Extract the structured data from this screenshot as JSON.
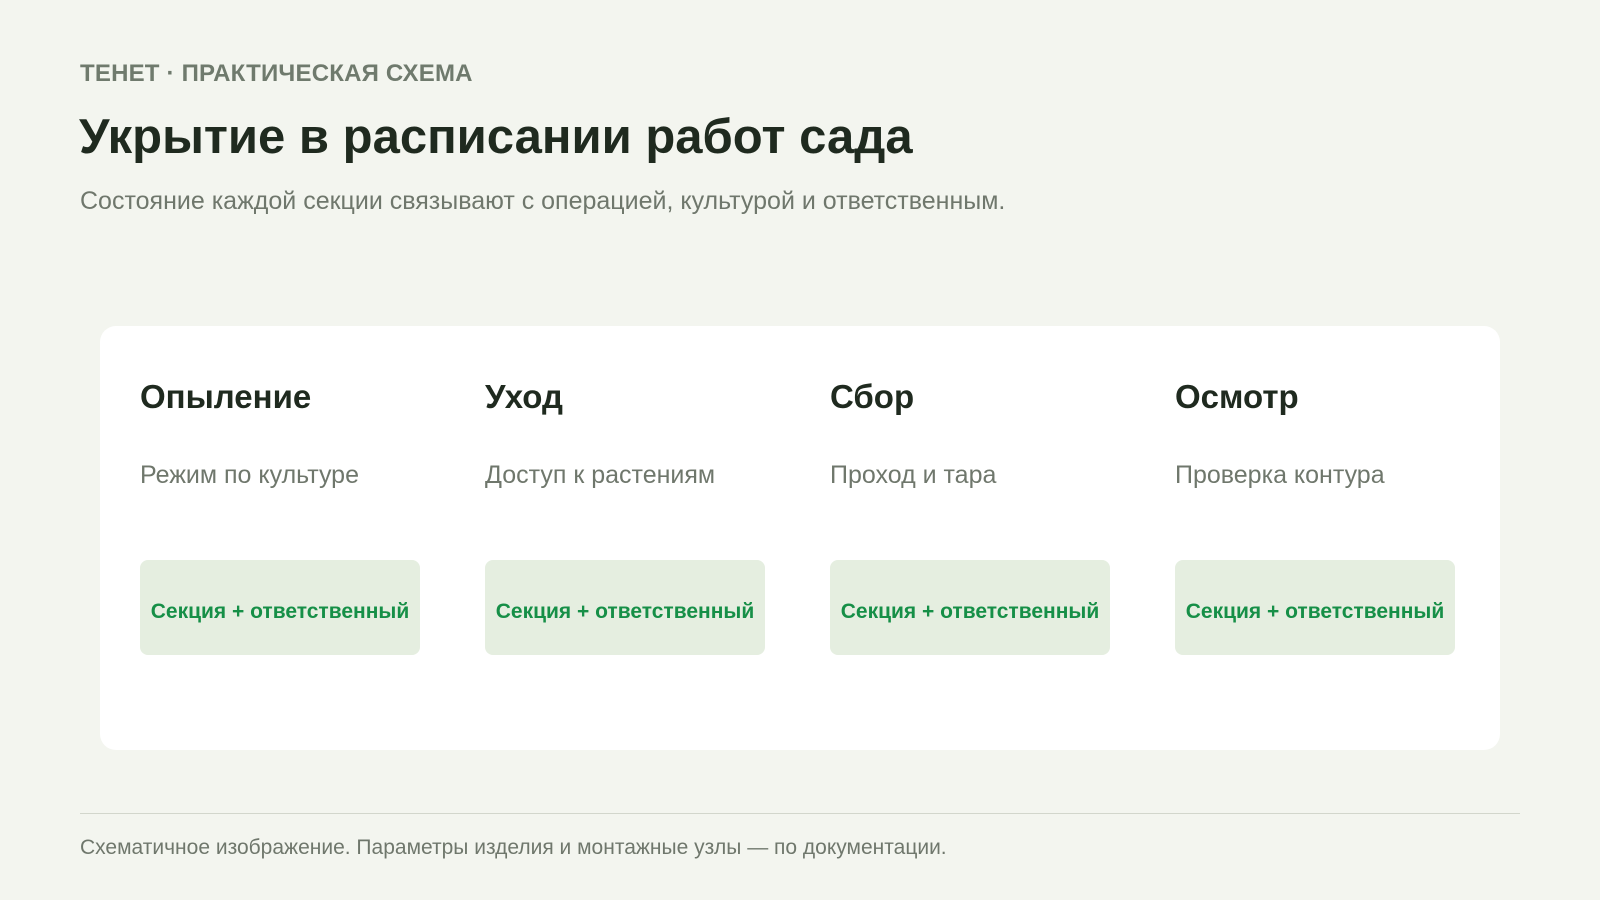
{
  "header": {
    "eyebrow": "ТЕНЕТ · ПРАКТИЧЕСКАЯ СХЕМА",
    "title": "Укрытие в расписании работ сада",
    "subtitle": "Состояние каждой секции связывают с операцией, культурой и ответственным."
  },
  "columns": [
    {
      "title": "Опыление",
      "description": "Режим по культуре",
      "chip": "Секция + ответственный"
    },
    {
      "title": "Уход",
      "description": "Доступ к растениям",
      "chip": "Секция + ответственный"
    },
    {
      "title": "Сбор",
      "description": "Проход и тара",
      "chip": "Секция + ответственный"
    },
    {
      "title": "Осмотр",
      "description": "Проверка контура",
      "chip": "Секция + ответственный"
    }
  ],
  "footer": {
    "note": "Схематичное изображение. Параметры изделия и монтажные узлы — по документации."
  },
  "colors": {
    "background": "#f3f5ef",
    "panel": "#ffffff",
    "chip_background": "#e5eee0",
    "chip_text": "#168f47",
    "heading": "#1f2a1f",
    "muted_text": "#6f776c"
  }
}
